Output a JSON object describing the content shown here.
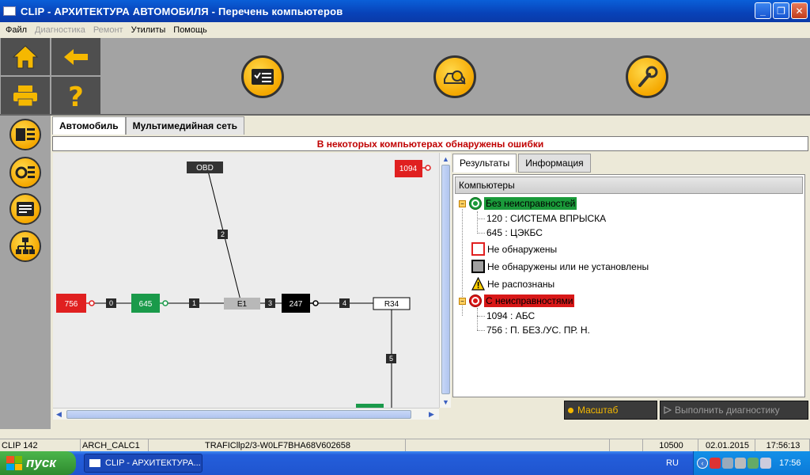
{
  "window": {
    "title": "CLIP - АРХИТЕКТУРА АВТОМОБИЛЯ - Перечень компьютеров",
    "minimize": "_",
    "maximize": "❐",
    "close": "✕"
  },
  "menu": [
    {
      "label": "Файл",
      "enabled": true
    },
    {
      "label": "Диагностика",
      "enabled": false
    },
    {
      "label": "Ремонт",
      "enabled": false
    },
    {
      "label": "Утилиты",
      "enabled": true
    },
    {
      "label": "Помощь",
      "enabled": true
    }
  ],
  "tabs": [
    {
      "label": "Автомобиль",
      "active": true
    },
    {
      "label": "Мультимедийная сеть",
      "active": false
    }
  ],
  "banner": "В некоторых компьютерах обнаружены ошибки",
  "diagram": {
    "nodes": [
      {
        "id": "obd",
        "label": "OBD"
      },
      {
        "id": "n1094",
        "label": "1094"
      },
      {
        "id": "n756",
        "label": "756"
      },
      {
        "id": "n645",
        "label": "645"
      },
      {
        "id": "e1",
        "label": "E1"
      },
      {
        "id": "n247",
        "label": "247"
      },
      {
        "id": "r34",
        "label": "R34"
      }
    ],
    "links": [
      {
        "label": "0"
      },
      {
        "label": "1"
      },
      {
        "label": "2"
      },
      {
        "label": "3"
      },
      {
        "label": "4"
      },
      {
        "label": "5"
      }
    ]
  },
  "right_tabs": [
    {
      "label": "Результаты",
      "active": true
    },
    {
      "label": "Информация",
      "active": false
    }
  ],
  "tree": {
    "header": "Компьютеры",
    "ok_group": {
      "label": "Без неисправностей",
      "expander": "−"
    },
    "ok_items": [
      "120 : СИСТЕМА ВПРЫСКА",
      "645 : ЦЭКБС"
    ],
    "legend": [
      {
        "label": "Не обнаружены",
        "icon": "red-outline-square-icon"
      },
      {
        "label": "Не обнаружены или не установлены",
        "icon": "grey-square-icon"
      },
      {
        "label": "Не распознаны",
        "icon": "warning-icon"
      }
    ],
    "err_group": {
      "label": "С неисправностями",
      "expander": "−"
    },
    "err_items": [
      "1094 : АБС",
      "756 : П. БЕЗ./УС. ПР. Н."
    ]
  },
  "buttons": {
    "scale": "Масштаб",
    "run": "Выполнить диагностику"
  },
  "status": {
    "clip": "CLIP 142",
    "arch": "ARCH_CALC1",
    "vehicle": "TRAFICllp2/3-W0LF7BHA68V602658",
    "num": "10500",
    "date": "02.01.2015",
    "time": "17:56:13"
  },
  "taskbar": {
    "start": "пуск",
    "task": "CLIP - АРХИТЕКТУРА...",
    "lang": "RU",
    "clock": "17:56"
  },
  "colors": {
    "accent": "#f5a800",
    "error": "#e02020",
    "ok": "#1a9a3a"
  }
}
